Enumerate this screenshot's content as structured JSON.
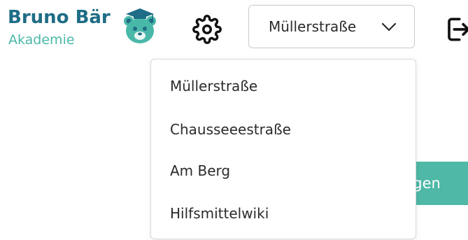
{
  "logo": {
    "title": "Bruno Bär",
    "subtitle": "Akademie",
    "icon": "bear-mascot-icon"
  },
  "header": {
    "settings_icon": "gear-icon",
    "logout_icon": "logout-icon"
  },
  "location_select": {
    "selected": "Müllerstraße",
    "icon": "chevron-down-icon"
  },
  "dropdown": {
    "items": [
      {
        "label": "Müllerstraße"
      },
      {
        "label": "Chausseeestraße"
      },
      {
        "label": "Am Berg"
      },
      {
        "label": "Hilfsmittelwiki"
      }
    ]
  },
  "add_button": {
    "label": "ügen"
  },
  "colors": {
    "brand_dark": "#1f6d86",
    "brand_accent": "#4ab8a8",
    "button_green": "#4fb8a6"
  }
}
